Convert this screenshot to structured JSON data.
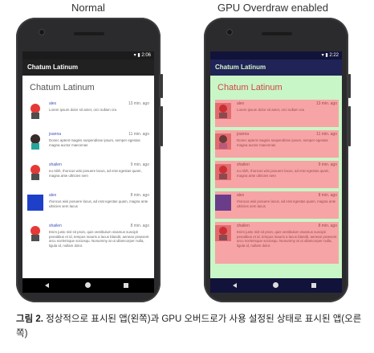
{
  "labels": {
    "left": "Normal",
    "right": "GPU Overdraw enabled"
  },
  "phone": {
    "time_left": "2:06",
    "time_right": "2:22",
    "app_title": "Chatum Latinum",
    "content_title": "Chatum Latinum",
    "messages": [
      {
        "name": "alex",
        "time": "13 min. ago",
        "text": "Lorem ipsum dolor sit amet, orci nullam cra",
        "avatar_color": "#e53935"
      },
      {
        "name": "joanna",
        "time": "11 min. ago",
        "text": "Donec aptent magnis suspendisse ipsum, semper egestas magna auctor maecenas",
        "avatar_color": "#26a69a"
      },
      {
        "name": "shailen",
        "time": "9 min. ago",
        "text": "eu nibh, rhoncus wisi posuere lacus, ad erat egestas quam, magna ante ultricies sem",
        "avatar_color": "#e53935"
      },
      {
        "name": "alex",
        "time": "8 min. ago",
        "text": "rhoncus wisi posuere lacus, ad erat egestas quam, magna ante ultricies sem lacus",
        "avatar_color": "#1e40c8"
      },
      {
        "name": "shailen",
        "time": "8 min. ago",
        "text": "Enim justo nisl sit proin, quis vestibulum vivamus suscipit penatibus et id, tempus mauris a lacus blandit, aenean praesent arcu scelerisque sociosqu. Nonummy at ut ullamcorper nulla, ligula id, nullam dolor.",
        "avatar_color": "#e53935"
      }
    ]
  },
  "caption": {
    "bold": "그림 2.",
    "text": " 정상적으로 표시된 앱(왼쪽)과 GPU 오버드로가 사용 설정된 상태로 표시된 앱(오른쪽)"
  },
  "colors": {
    "overdraw_green": "#c9f6c6",
    "overdraw_red": "#f7a4a6",
    "appbar_dark": "#212121"
  }
}
